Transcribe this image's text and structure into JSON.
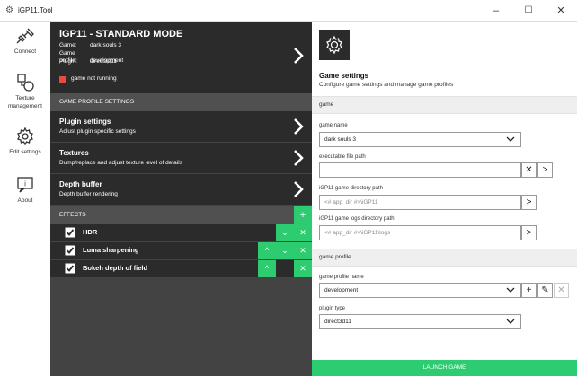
{
  "window": {
    "title": "iGP11.Tool",
    "controls": {
      "minimize": "–",
      "maximize": "☐",
      "close": "✕"
    }
  },
  "sidebar": {
    "items": [
      {
        "label": "Connect",
        "icon": "plug-icon"
      },
      {
        "label": "Texture management",
        "icon": "shapes-icon"
      },
      {
        "label": "Edit settings",
        "icon": "gear-icon"
      },
      {
        "label": "About",
        "icon": "info-icon"
      }
    ]
  },
  "status": {
    "title": "iGP11 - STANDARD MODE",
    "game_key": "Game:",
    "game_val": "dark souls 3",
    "profile_key": "Game profile:",
    "profile_val": "development",
    "plugin_key": "Plugin:",
    "plugin_val": "direct3d11",
    "running_text": "game not running",
    "running_color": "#e74c3c"
  },
  "profile_settings": {
    "header": "GAME PROFILE SETTINGS",
    "items": [
      {
        "title": "Plugin settings",
        "subtitle": "Adjust plugin specific settings"
      },
      {
        "title": "Textures",
        "subtitle": "Dump/replace and adjust texture level of details"
      },
      {
        "title": "Depth buffer",
        "subtitle": "Depth buffer rendering"
      }
    ]
  },
  "effects": {
    "header": "EFFECTS",
    "add": "+",
    "items": [
      {
        "name": "HDR",
        "checked": true
      },
      {
        "name": "Luma sharpening",
        "checked": true
      },
      {
        "name": "Bokeh depth of field",
        "checked": true
      }
    ],
    "up": "^",
    "down": "⌄",
    "remove": "✕"
  },
  "game_settings": {
    "title": "Game settings",
    "subtitle": "Configure game settings and manage game profiles",
    "group_game": "game",
    "game_name_label": "game name",
    "game_name_value": "dark souls 3",
    "exe_label": "executable file path",
    "exe_value": "",
    "dir_label": "iGP11 game directory path",
    "dir_placeholder": "<# app_dir #>\\iGP11",
    "logs_label": "iGP11 game logs directory path",
    "logs_placeholder": "<# app_dir #>\\iGP11\\logs",
    "group_profile": "game profile",
    "profile_label": "game profile name",
    "profile_value": "development",
    "plugin_label": "plugin type",
    "plugin_value": "direct3d11",
    "launch": "LAUNCH GAME",
    "btn_clear": "✕",
    "btn_browse": ">",
    "btn_add": "+",
    "btn_edit": "✎",
    "btn_delete": "✕"
  },
  "colors": {
    "accent": "#2ecc71",
    "dark": "#2b2b2b",
    "panel": "#434343"
  }
}
